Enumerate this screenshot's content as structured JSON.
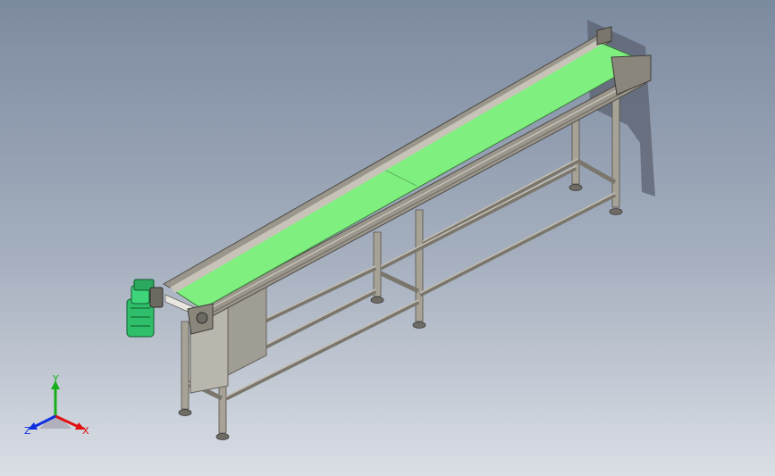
{
  "viewport": {
    "background_top": "#7c8aa0",
    "background_bottom": "#dadee5"
  },
  "model": {
    "belt_color": "#7ff07f",
    "frame_color": "#8e8a80",
    "motor_color": "#2fbf6a"
  },
  "triad": {
    "x_label": "X",
    "y_label": "Y",
    "z_label": "Z",
    "x_color": "#e01010",
    "y_color": "#18b018",
    "z_color": "#1030e0"
  }
}
